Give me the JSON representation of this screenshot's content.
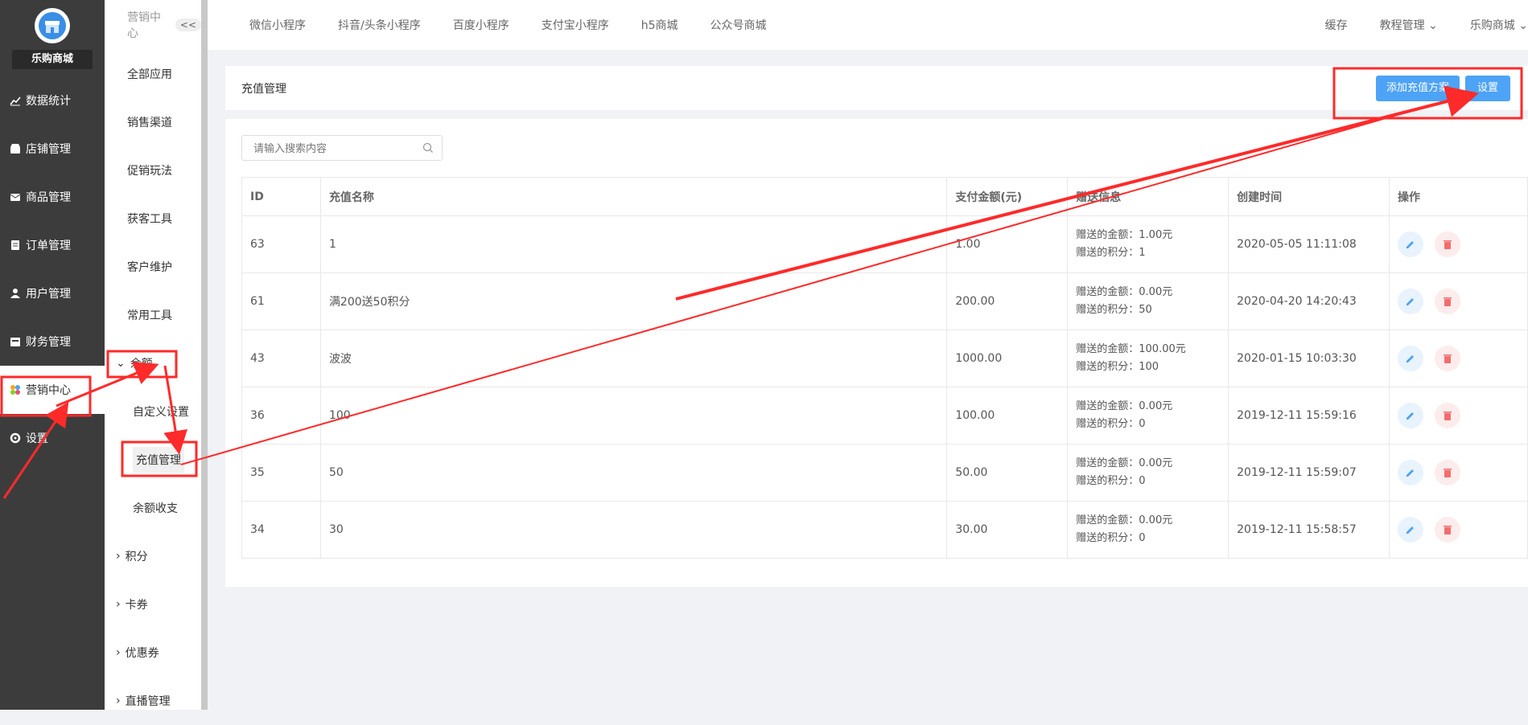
{
  "sidebar": {
    "store_name": "乐购商城",
    "items": [
      {
        "label": "数据统计",
        "icon": "chart-icon"
      },
      {
        "label": "店铺管理",
        "icon": "store-icon"
      },
      {
        "label": "商品管理",
        "icon": "mail-icon"
      },
      {
        "label": "订单管理",
        "icon": "order-icon"
      },
      {
        "label": "用户管理",
        "icon": "user-icon"
      },
      {
        "label": "财务管理",
        "icon": "finance-icon"
      },
      {
        "label": "营销中心",
        "icon": "marketing-icon"
      },
      {
        "label": "设置",
        "icon": "gear-icon"
      }
    ]
  },
  "subnav": {
    "title": "营销中心",
    "collapse": "<<",
    "items": [
      "全部应用",
      "销售渠道",
      "促销玩法",
      "获客工具",
      "客户维护",
      "常用工具"
    ],
    "balance_group": "余额",
    "balance_children": [
      "自定义设置",
      "充值管理",
      "余额收支"
    ],
    "groups": [
      "积分",
      "卡券",
      "优惠券",
      "直播管理"
    ]
  },
  "topbar": {
    "tabs": [
      "微信小程序",
      "抖音/头条小程序",
      "百度小程序",
      "支付宝小程序",
      "h5商城",
      "公众号商城"
    ],
    "cache": "缓存",
    "tutorial": "教程管理",
    "store": "乐购商城"
  },
  "page": {
    "title": "充值管理",
    "add_button": "添加充值方案",
    "settings_button": "设置",
    "search_placeholder": "请输入搜索内容"
  },
  "table": {
    "headers": [
      "ID",
      "充值名称",
      "支付金额(元)",
      "赠送信息",
      "创建时间",
      "操作"
    ],
    "rows": [
      {
        "id": "63",
        "name": "1",
        "amount": "1.00",
        "gift_money": "赠送的金额：1.00元",
        "gift_points": "赠送的积分：1",
        "created": "2020-05-05 11:11:08"
      },
      {
        "id": "61",
        "name": "满200送50积分",
        "amount": "200.00",
        "gift_money": "赠送的金额：0.00元",
        "gift_points": "赠送的积分：50",
        "created": "2020-04-20 14:20:43"
      },
      {
        "id": "43",
        "name": "波波",
        "amount": "1000.00",
        "gift_money": "赠送的金额：100.00元",
        "gift_points": "赠送的积分：100",
        "created": "2020-01-15 10:03:30"
      },
      {
        "id": "36",
        "name": "100",
        "amount": "100.00",
        "gift_money": "赠送的金额：0.00元",
        "gift_points": "赠送的积分：0",
        "created": "2019-12-11 15:59:16"
      },
      {
        "id": "35",
        "name": "50",
        "amount": "50.00",
        "gift_money": "赠送的金额：0.00元",
        "gift_points": "赠送的积分：0",
        "created": "2019-12-11 15:59:07"
      },
      {
        "id": "34",
        "name": "30",
        "amount": "30.00",
        "gift_money": "赠送的金额：0.00元",
        "gift_points": "赠送的积分：0",
        "created": "2019-12-11 15:58:57"
      }
    ]
  },
  "colors": {
    "accent": "#4da3f5",
    "sidebar": "#3c3c3c",
    "annotation": "#ff2a2a",
    "delete": "#f56c6c"
  }
}
